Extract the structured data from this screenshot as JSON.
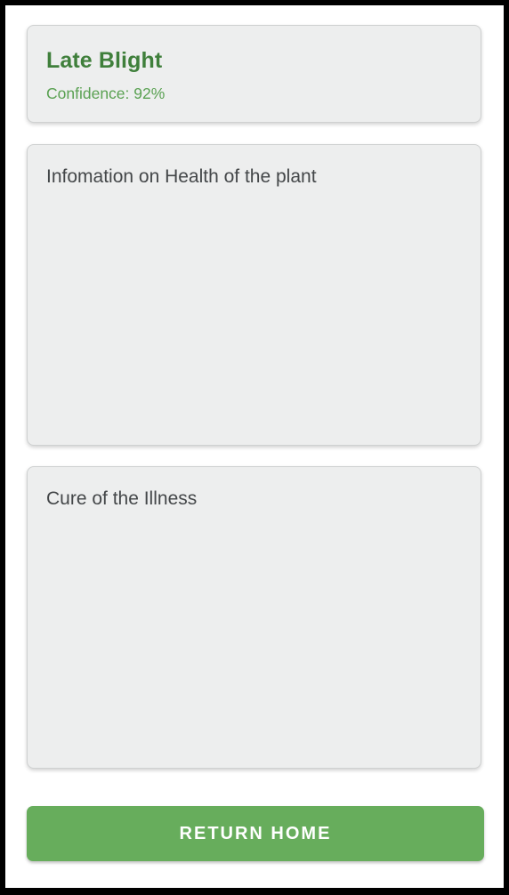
{
  "result": {
    "diagnosis": "Late Blight",
    "confidence_text": "Confidence: 92%"
  },
  "info": {
    "text": "Infomation on Health of the plant"
  },
  "cure": {
    "text": "Cure of the Illness"
  },
  "actions": {
    "return_home_label": "RETURN HOME"
  },
  "colors": {
    "primary_green": "#67ad5c",
    "title_green": "#3f7f3b",
    "card_background": "#edeeee"
  }
}
